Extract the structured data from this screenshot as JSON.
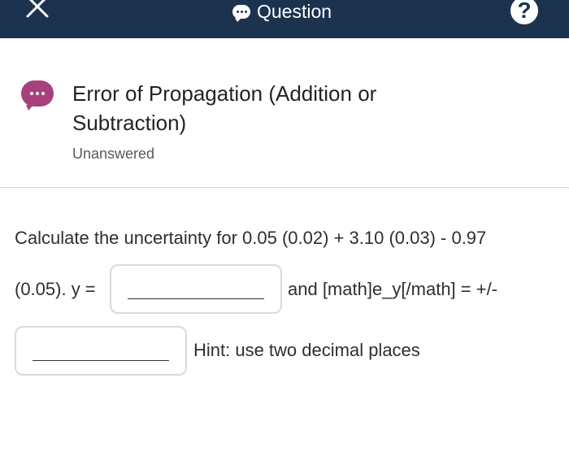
{
  "header": {
    "title": "Question",
    "help_label": "?",
    "close_icon": "close-icon",
    "title_icon": "chat-bubble-icon",
    "bar_color": "#1c3350"
  },
  "question": {
    "icon": "chat-bubble-icon",
    "icon_color": "#a8407e",
    "title": "Error of Propagation (Addition or Subtraction)",
    "status": "Unanswered"
  },
  "body": {
    "line1": "Calculate the uncertainty for 0.05 (0.02) + 3.10 (0.03) - 0.97",
    "line2_prefix": "(0.05). y =",
    "line2_suffix": "and [math]e_y[/math] = +/-",
    "hint": "Hint: use two decimal places"
  }
}
